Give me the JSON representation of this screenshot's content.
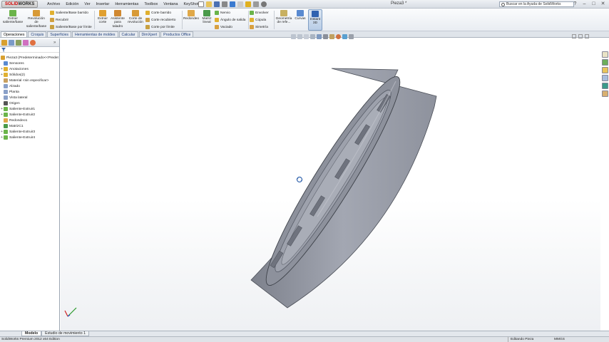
{
  "titlebar": {
    "logo_brand": "SOLID",
    "logo_brand2": "WORKS",
    "menus": [
      "Archivo",
      "Edición",
      "Ver",
      "Insertar",
      "Herramientas",
      "Toolbox",
      "Ventana",
      "KeyShot 4"
    ],
    "document_title": "Pieza3 *",
    "help_placeholder": "Buscar en la Ayuda de SolidWorks"
  },
  "ribbon": {
    "extrude_boss": "Extruir saliente/base",
    "revolve_boss": "Revolución de saliente/base",
    "swept_boss": "Saliente/Base barrido",
    "loft": "Recubrir",
    "boundary_boss": "Saliente/Base por límite",
    "extrude_cut": "Extruir corte",
    "hole_wizard": "Asistente para taladro",
    "revolve_cut": "Corte de revolución",
    "swept_cut": "Corte barrido",
    "lofted_cut": "Corte recubierto",
    "boundary_cut": "Corte por límite",
    "fillet": "Redondeo",
    "linear_pattern": "Matriz lineal",
    "rib": "Nervio",
    "draft": "Ángulo de salida",
    "shell": "Vaciado",
    "wrap": "Envolver",
    "dome": "Cúpula",
    "mirror": "Simetría",
    "reference_geometry": "Geometría de refe...",
    "curves": "Curvas",
    "instant3d": "Instant 3D"
  },
  "tabs": [
    "Operaciones",
    "Croquis",
    "Superficies",
    "Herramientas de moldes",
    "Calcular",
    "DimXpert",
    "Productos Office"
  ],
  "active_tab": "Operaciones",
  "tree": {
    "root": "Pieza3  (Predeterminado<<Predet",
    "items": [
      {
        "label": "Sensores",
        "expandable": false
      },
      {
        "label": "Anotaciones",
        "expandable": true
      },
      {
        "label": "Sólidos(2)",
        "expandable": true
      },
      {
        "label": "Material <sin especificar>",
        "expandable": false
      },
      {
        "label": "Alzado",
        "expandable": false
      },
      {
        "label": "Planta",
        "expandable": false
      },
      {
        "label": "Vista lateral",
        "expandable": false
      },
      {
        "label": "Origen",
        "expandable": false
      },
      {
        "label": "Saliente-Extruir1",
        "expandable": true
      },
      {
        "label": "Saliente-Extruir2",
        "expandable": true
      },
      {
        "label": "Redondeo1",
        "expandable": false
      },
      {
        "label": "MatrizC1",
        "expandable": false
      },
      {
        "label": "Saliente-Extruir3",
        "expandable": true
      },
      {
        "label": "Saliente-Extruir4",
        "expandable": true
      }
    ]
  },
  "bottom_tabs": [
    "Modelo",
    "Estudio de movimiento 1"
  ],
  "active_bottom_tab": "Modelo",
  "status": {
    "edition": "SolidWorks Premium 2012 x64 Edition",
    "mode": "Editando Pieza",
    "units": "MMGS"
  },
  "colors": {
    "part_face": "#8d919c",
    "part_rim": "#9a9eaa",
    "accent": "#1d3d7a"
  }
}
